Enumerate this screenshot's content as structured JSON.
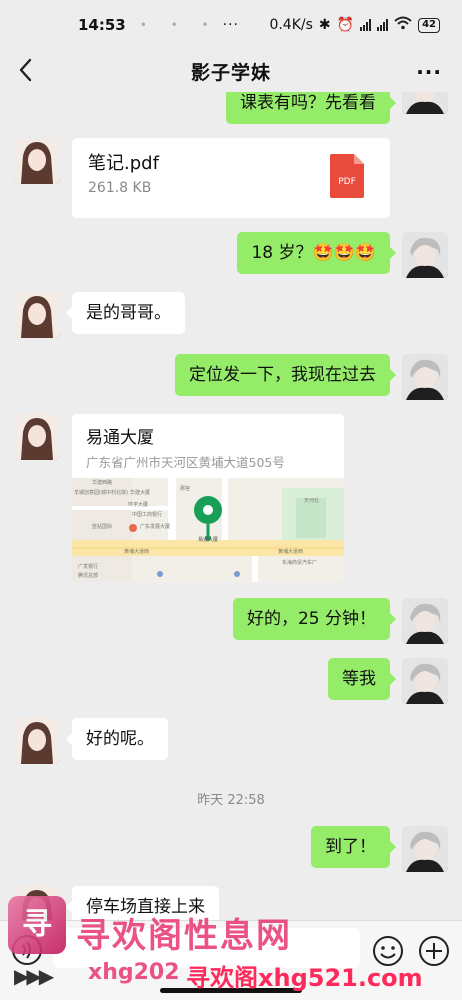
{
  "status_bar": {
    "time": "14:53",
    "dots": "• • •",
    "more": "···",
    "net_speed": "0.4K/s",
    "battery": "42"
  },
  "header": {
    "title": "影子学妹",
    "menu": "···"
  },
  "messages": [
    {
      "side": "out",
      "type": "text",
      "text": "课表有吗？先看看"
    },
    {
      "side": "in",
      "type": "file",
      "file_name": "笔记.pdf",
      "file_size": "261.8 KB",
      "file_type": "PDF"
    },
    {
      "side": "out",
      "type": "text",
      "text": "18 岁？🤩🤩🤩"
    },
    {
      "side": "in",
      "type": "text",
      "text": "是的哥哥。"
    },
    {
      "side": "out",
      "type": "text",
      "text": "定位发一下，我现在过去"
    },
    {
      "side": "in",
      "type": "location",
      "place": "易通大厦",
      "address": "广东省广州市天河区黄埔大道505号",
      "map_labels": [
        "华建西路",
        "羊城创意园(城中村北岸)",
        "华建大厦",
        "环宇大厦",
        "中国工商银行",
        "蓝钻国际",
        "广东发展大厦",
        "黄埔大道西",
        "黄埔大道西",
        "广发银行",
        "腾讯总部",
        "易通大厦",
        "那宫",
        "东海商贸汽车厂",
        "天河北"
      ]
    },
    {
      "side": "out",
      "type": "text",
      "text": "好的，25 分钟！"
    },
    {
      "side": "out",
      "type": "text",
      "text": "等我"
    },
    {
      "side": "in",
      "type": "text",
      "text": "好的呢。"
    },
    {
      "side": "sep",
      "type": "time",
      "text": "昨天 22:58"
    },
    {
      "side": "out",
      "type": "text",
      "text": "到了！"
    },
    {
      "side": "in",
      "type": "text",
      "text": "停车场直接上来"
    }
  ],
  "watermark": {
    "logo_char": "寻",
    "title": "寻欢阁性息网",
    "url_left": "xhg202",
    "url_main": "寻欢阁xhg521.com"
  },
  "colors": {
    "background": "#ededed",
    "out_bubble": "#95ec69",
    "in_bubble": "#ffffff",
    "pdf_red": "#e94b3c",
    "map_pin": "#18a058",
    "watermark": "#e8366f"
  }
}
